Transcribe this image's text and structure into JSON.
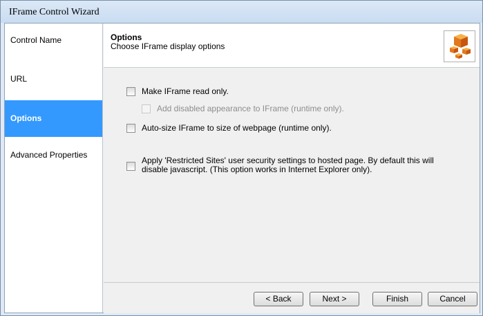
{
  "window": {
    "title": "IFrame Control Wizard"
  },
  "sidebar": {
    "items": [
      {
        "label": "Control Name",
        "active": false
      },
      {
        "label": "URL",
        "active": false
      },
      {
        "label": "Options",
        "active": true
      },
      {
        "label": "Advanced Properties",
        "active": false
      }
    ]
  },
  "header": {
    "title": "Options",
    "subtitle": "Choose IFrame display options",
    "icon": "cubes-icon"
  },
  "options": [
    {
      "label": "Make IFrame read only.",
      "checked": false,
      "enabled": true
    },
    {
      "label": "Add disabled appearance to IFrame (runtime only).",
      "checked": false,
      "enabled": false
    },
    {
      "label": "Auto-size IFrame to size of webpage (runtime only).",
      "checked": false,
      "enabled": true
    },
    {
      "label": "Apply 'Restricted Sites' user security settings to hosted page. By default this will disable javascript. (This option works in Internet Explorer only).",
      "checked": false,
      "enabled": true
    }
  ],
  "buttons": {
    "back": "< Back",
    "next": "Next >",
    "finish": "Finish",
    "cancel": "Cancel"
  },
  "colors": {
    "active_nav": "#3399ff",
    "title_bar": "#c9dcf1",
    "panel": "#f0f0f0"
  }
}
